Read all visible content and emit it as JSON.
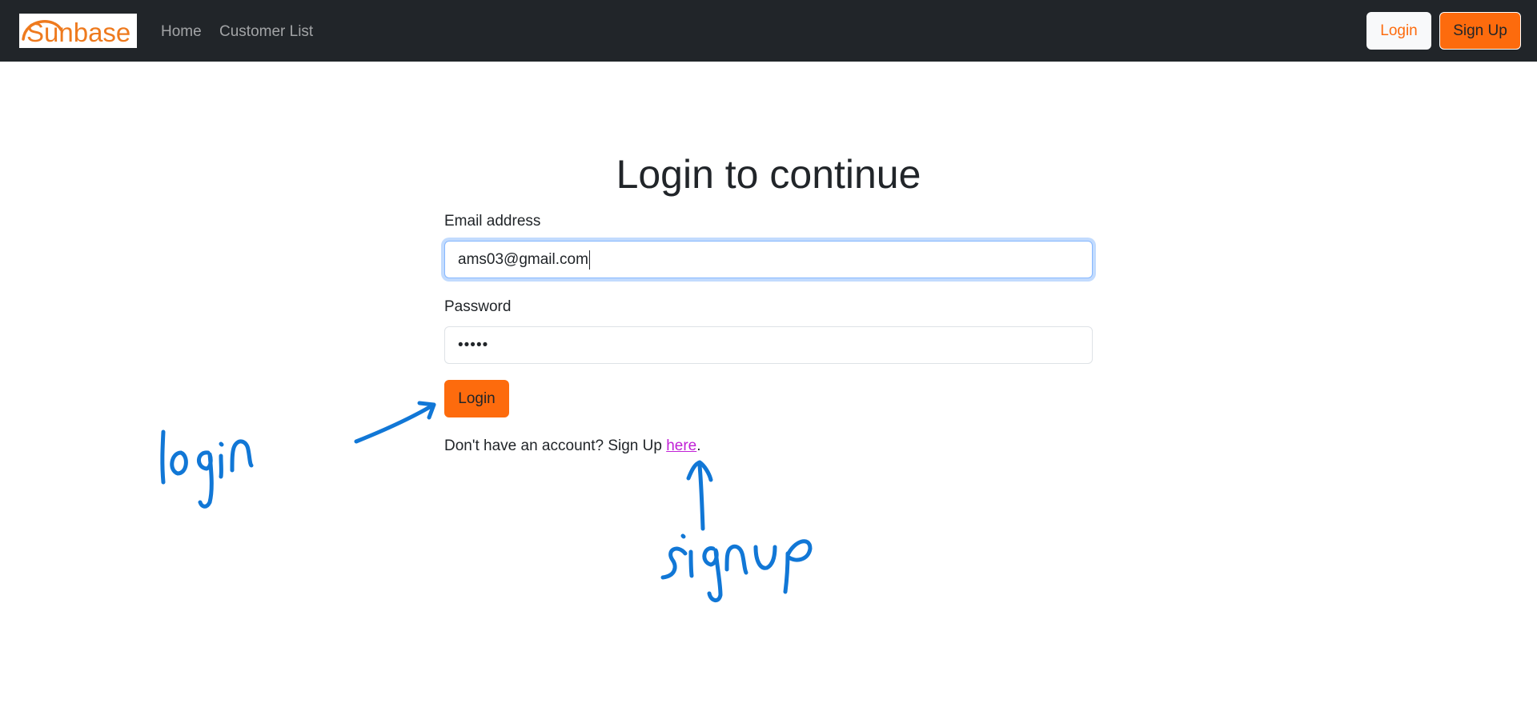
{
  "navbar": {
    "logo_text": "Sunbase",
    "links": [
      {
        "label": "Home"
      },
      {
        "label": "Customer List"
      }
    ],
    "login_label": "Login",
    "signup_label": "Sign Up"
  },
  "main": {
    "title": "Login to continue",
    "email": {
      "label": "Email address",
      "value": "ams03@gmail.com"
    },
    "password": {
      "label": "Password",
      "masked_value": "•••••"
    },
    "submit_label": "Login",
    "signup_prompt": "Don't have an account? Sign Up ",
    "signup_link": "here",
    "signup_suffix": "."
  },
  "annotations": {
    "login_note": "login",
    "signup_note": "signup",
    "color": "#1177d6"
  },
  "colors": {
    "navbar_bg": "#212529",
    "accent": "#fd6b0d",
    "link": "#c120d6",
    "logo": "#ee7a1e"
  }
}
